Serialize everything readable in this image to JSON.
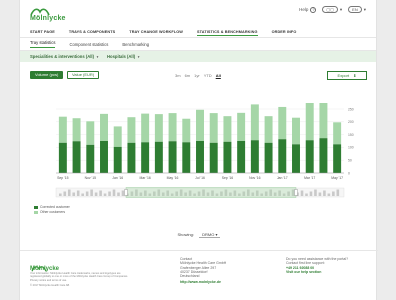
{
  "header": {
    "brand": "Mölnlycke",
    "help_label": "Help",
    "menu_label": "",
    "user_label": "EN",
    "nav": [
      "START PAGE",
      "TRAYS & COMPONENTS",
      "TRAY CHANGE WORKFLOW",
      "STATISTICS & BENCHMARKING",
      "ORDER INFO"
    ],
    "active_nav": "STATISTICS & BENCHMARKING"
  },
  "subtabs": [
    "Tray statistics",
    "Component statistics",
    "Benchmarking"
  ],
  "filters": [
    {
      "label": "Specialities & interventions (All)"
    },
    {
      "label": "Hospitals (All)"
    }
  ],
  "controls": {
    "toggle_on": "Volume (pcs)",
    "toggle_off": "Value (EUR)",
    "ranges": [
      "3m",
      "6m",
      "1yr",
      "YTD",
      "All"
    ],
    "selected_range": "All",
    "export_label": "Export"
  },
  "colors": {
    "brand": "#3b9a3f",
    "dark_green": "#2e7d32",
    "light_green": "#a5d6a7"
  },
  "chart_data": {
    "type": "bar",
    "stacked": true,
    "categories": [
      "Sep '15",
      "Oct '15",
      "Nov '15",
      "Dec '15",
      "Jan '16",
      "Feb '16",
      "Mar '16",
      "Apr '16",
      "May '16",
      "Jun '16",
      "Jul '16",
      "Aug '16",
      "Sep '16",
      "Oct '16",
      "Nov '16",
      "Dec '16",
      "Jan '17",
      "Feb '17",
      "Mar '17",
      "Apr '17",
      "May '17"
    ],
    "x_tick_labels": [
      "Sep '15",
      "Nov '15",
      "Jan '16",
      "Mar '16",
      "May '16",
      "Jul '16",
      "Sep '16",
      "Nov '16",
      "Jan '17",
      "Mar '17",
      "May '17"
    ],
    "series": [
      {
        "name": "Corrected customer",
        "values": [
          118,
          124,
          110,
          125,
          102,
          118,
          120,
          122,
          124,
          120,
          125,
          118,
          122,
          125,
          128,
          118,
          132,
          112,
          128,
          136,
          112
        ]
      },
      {
        "name": "Other customer",
        "values": [
          102,
          90,
          92,
          106,
          80,
          100,
          112,
          108,
          110,
          92,
          122,
          116,
          100,
          110,
          140,
          104,
          126,
          104,
          146,
          140,
          86
        ]
      }
    ],
    "ylabel": "",
    "yticks": [
      "250",
      "200",
      "150",
      "100",
      "50",
      "0"
    ],
    "ylim": [
      0,
      250
    ]
  },
  "legend": [
    {
      "label": "Corrected customer",
      "color": "#2e7d32"
    },
    {
      "label": "Other customers",
      "color": "#a5d6a7"
    }
  ],
  "showing": {
    "label": "Showing:",
    "value": "DRMO"
  },
  "footer": {
    "brand": "Mölnlycke",
    "disclaimer": "Your information: Mölnlycke Health Care trademarks, names and logotypes are registered globally to one or more of the Mölnlycke Health Care Group of Companies. Privacy notice and terms of use.",
    "copyright": "© 2017 Mölnlycke Health Care AB",
    "contact_title": "Contact",
    "contact_lines": [
      "Mölnlycke Health Care GmbH",
      "Grafenberger Allee 297",
      "40237 Düsseldorf",
      "Deutschland"
    ],
    "contact_link": "http://www.molnlycke.de",
    "help_q": "Do you need assistance with the portal?",
    "help_line": "Contact first line support:",
    "help_phone": "+49 211 92088 00",
    "help_link": "Visit our help section"
  }
}
